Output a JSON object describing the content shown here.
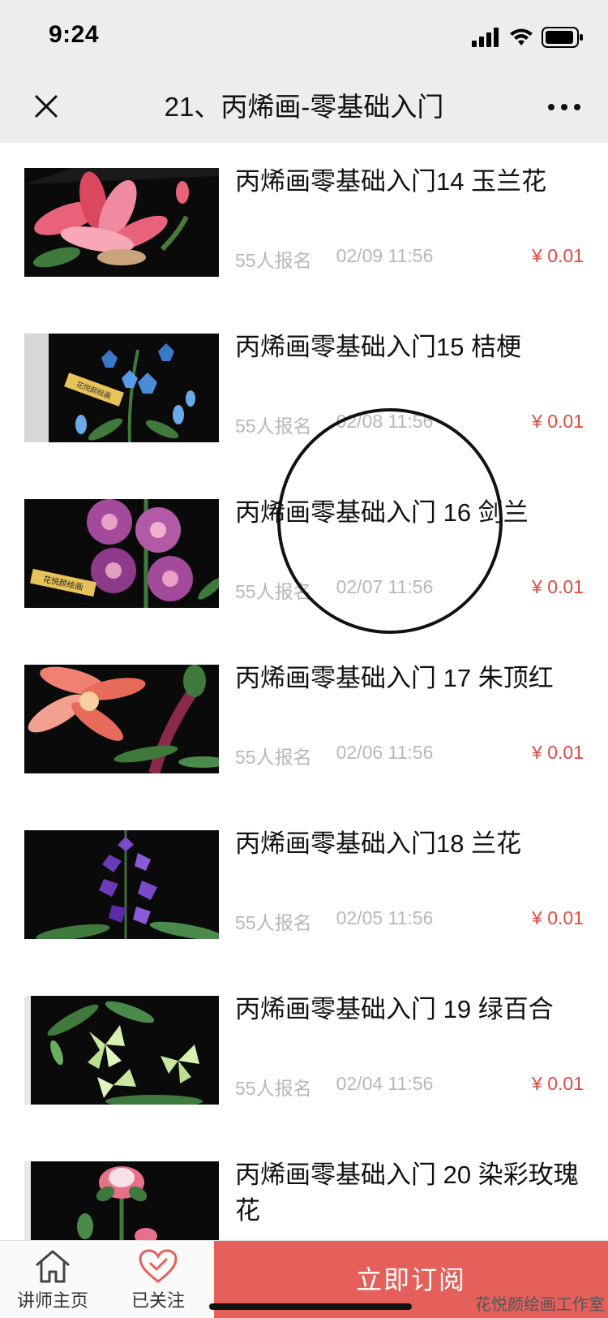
{
  "status_bar": {
    "time": "9:24"
  },
  "nav": {
    "title": "21、丙烯画-零基础入门"
  },
  "items": [
    {
      "title": "丙烯画零基础入门14 玉兰花",
      "signups": "55人报名",
      "date": "02/09 11:56",
      "price": "¥ 0.01"
    },
    {
      "title": "丙烯画零基础入门15 桔梗",
      "signups": "55人报名",
      "date": "02/08 11:56",
      "price": "¥ 0.01"
    },
    {
      "title": "丙烯画零基础入门 16 剑兰",
      "signups": "55人报名",
      "date": "02/07 11:56",
      "price": "¥ 0.01"
    },
    {
      "title": "丙烯画零基础入门 17 朱顶红",
      "signups": "55人报名",
      "date": "02/06 11:56",
      "price": "¥ 0.01"
    },
    {
      "title": "丙烯画零基础入门18 兰花",
      "signups": "55人报名",
      "date": "02/05 11:56",
      "price": "¥ 0.01"
    },
    {
      "title": "丙烯画零基础入门 19 绿百合",
      "signups": "55人报名",
      "date": "02/04 11:56",
      "price": "¥ 0.01"
    },
    {
      "title": "丙烯画零基础入门 20 染彩玫瑰花"
    }
  ],
  "thumb_badges": {
    "item2": "花悦颜绘画",
    "item3": "花悦颜绘画"
  },
  "bottom_bar": {
    "teacher_label": "讲师主页",
    "follow_label": "已关注",
    "subscribe_label": "立即订阅",
    "watermark": "花悦颜绘画工作室"
  },
  "colors": {
    "price": "#e04a3f",
    "subscribe_bg": "#e5605a",
    "follow_icon": "#e5605a",
    "meta": "#b8b8b8"
  }
}
